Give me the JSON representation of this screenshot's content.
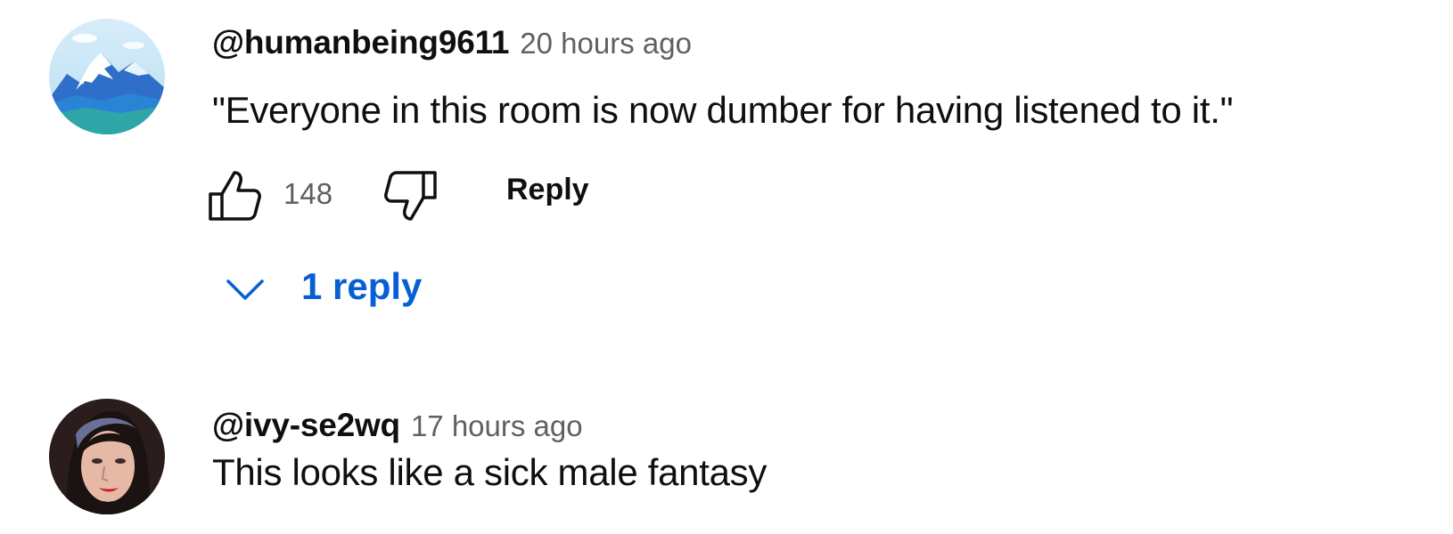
{
  "comments": [
    {
      "author": "@humanbeing9611",
      "timestamp": "20 hours ago",
      "text": "\"Everyone in this room is now dumber for having listened to it.\"",
      "like_count": "148",
      "reply_label": "Reply",
      "replies_label": "1 reply",
      "avatar_icon": "mountain-landscape-avatar"
    },
    {
      "author": "@ivy-se2wq",
      "timestamp": "17 hours ago",
      "text": "This looks like a sick male fantasy",
      "avatar_icon": "portrait-avatar"
    }
  ],
  "colors": {
    "link_blue": "#065fd4",
    "meta_gray": "#606060",
    "text_primary": "#0f0f0f"
  }
}
